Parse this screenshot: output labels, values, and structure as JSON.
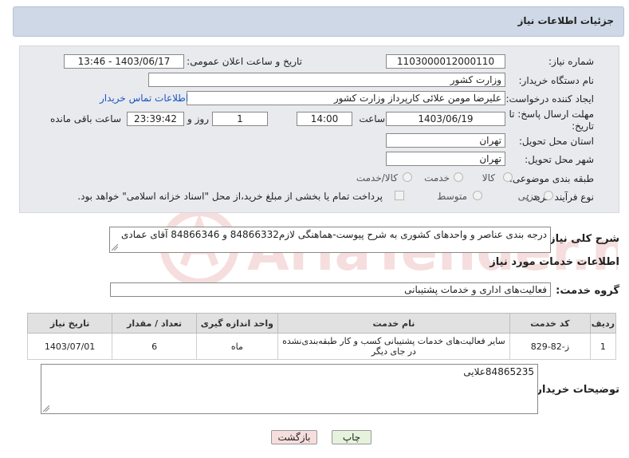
{
  "header": {
    "title": "جزئیات اطلاعات نیاز"
  },
  "form": {
    "need_number": {
      "label": "شماره نیاز:",
      "value": "1103000012000110"
    },
    "announce": {
      "label": "تاریخ و ساعت اعلان عمومی:",
      "value": "1403/06/17 - 13:46"
    },
    "buyer_org": {
      "label": "نام دستگاه خریدار:",
      "value": "وزارت کشور"
    },
    "requester": {
      "label": "ایجاد کننده درخواست:",
      "value": "علیرضا مومن علائی کارپرداز وزارت کشور",
      "contact_link": "اطلاعات تماس خریدار"
    },
    "deadline": {
      "label_line1": "مهلت ارسال پاسخ: تا",
      "label_line2": "تاریخ:",
      "date": "1403/06/19",
      "time_label": "ساعت",
      "time": "14:00",
      "days": "1",
      "days_label": "روز و",
      "remaining": "23:39:42",
      "remaining_label": "ساعت باقی مانده"
    },
    "province": {
      "label": "استان محل تحویل:",
      "value": "تهران"
    },
    "city": {
      "label": "شهر محل تحویل:",
      "value": "تهران"
    },
    "category": {
      "label": "طبقه بندی موضوعی:",
      "options": [
        "کالا",
        "خدمت",
        "کالا/خدمت"
      ]
    },
    "process": {
      "label": "نوع فرآیند خرید :",
      "options": [
        "جزیی",
        "متوسط"
      ],
      "payment_note": "پرداخت تمام یا بخشی از مبلغ خرید،از محل \"اسناد خزانه اسلامی\" خواهد بود."
    }
  },
  "summary": {
    "label": "شرح کلی نیاز:",
    "value": "درجه بندی عناصر و واحدهای کشوری به شرح پیوست-هماهنگی لازم84866332 و 84866346 آقای عمادی"
  },
  "services": {
    "section_title": "اطلاعات خدمات مورد نیاز",
    "group_label": "گروه خدمت:",
    "group_value": "فعالیت‌های اداری و خدمات پشتیبانی",
    "columns": [
      "ردیف",
      "کد خدمت",
      "نام خدمت",
      "واحد اندازه گیری",
      "تعداد / مقدار",
      "تاریخ نیاز"
    ],
    "rows": [
      {
        "index": "1",
        "code": "ز-82-829",
        "name": "سایر فعالیت‌های خدمات پشتیبانی کسب و کار طبقه‌بندی‌نشده در جای دیگر",
        "unit": "ماه",
        "qty": "6",
        "date": "1403/07/01"
      }
    ]
  },
  "buyer_notes": {
    "label": "توضیحات خریدار:",
    "value": "84865235علایی"
  },
  "buttons": {
    "print": "چاپ",
    "back": "بازگشت"
  },
  "watermark": {
    "text": "AriaTender.neT"
  }
}
